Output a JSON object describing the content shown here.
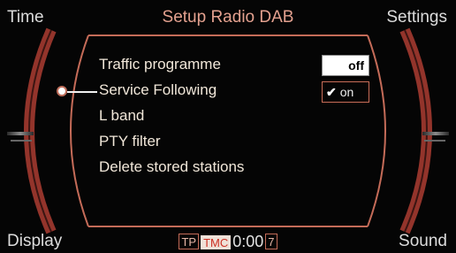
{
  "header": {
    "left": "Time",
    "title": "Setup Radio DAB",
    "right": "Settings"
  },
  "footer": {
    "left": "Display",
    "right": "Sound",
    "status": {
      "tp": "TP",
      "tmc": "TMC",
      "clock": "0:00",
      "preset": "7"
    }
  },
  "menu": {
    "items": [
      "Traffic programme",
      "Service Following",
      "L band",
      "PTY filter",
      "Delete stored stations"
    ],
    "selected_index": 1
  },
  "toggle": {
    "off_label": "off",
    "on_label": "on",
    "selected": "on"
  },
  "colors": {
    "title": "#e4a18f",
    "frame": "#b0473a",
    "menu_text": "#f1e7d9",
    "tmc_bg": "#f0e1d8",
    "tmc_text": "#cc2f22"
  }
}
